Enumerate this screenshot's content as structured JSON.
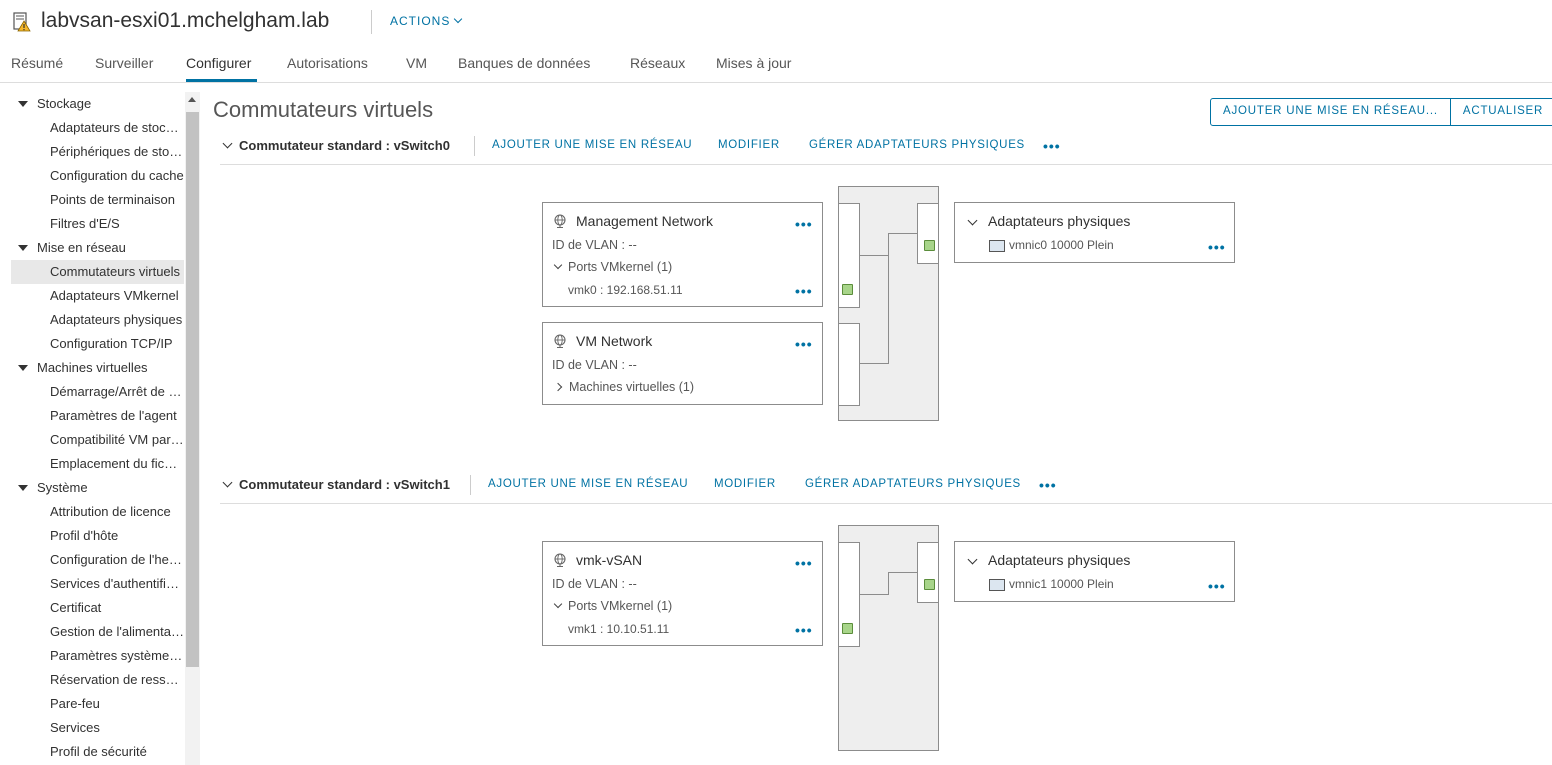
{
  "header": {
    "host_title": "labvsan-esxi01.mchelgham.lab",
    "actions_label": "ACTIONS"
  },
  "tabs": [
    "Résumé",
    "Surveiller",
    "Configurer",
    "Autorisations",
    "VM",
    "Banques de données",
    "Réseaux",
    "Mises à jour"
  ],
  "active_tab": "Configurer",
  "sidebar": {
    "rows": [
      {
        "label": "Stockage",
        "type": "cat"
      },
      {
        "label": "Adaptateurs de stockage",
        "type": "leaf"
      },
      {
        "label": "Périphériques de stockage",
        "type": "leaf"
      },
      {
        "label": "Configuration du cache",
        "type": "leaf"
      },
      {
        "label": "Points de terminaison",
        "type": "leaf"
      },
      {
        "label": "Filtres d'E/S",
        "type": "leaf"
      },
      {
        "label": "Mise en réseau",
        "type": "cat"
      },
      {
        "label": "Commutateurs virtuels",
        "type": "leaf",
        "selected": true
      },
      {
        "label": "Adaptateurs VMkernel",
        "type": "leaf"
      },
      {
        "label": "Adaptateurs physiques",
        "type": "leaf"
      },
      {
        "label": "Configuration TCP/IP",
        "type": "leaf"
      },
      {
        "label": "Machines virtuelles",
        "type": "cat"
      },
      {
        "label": "Démarrage/Arrêt de VM",
        "type": "leaf"
      },
      {
        "label": "Paramètres de l'agent",
        "type": "leaf"
      },
      {
        "label": "Compatibilité VM par défaut",
        "type": "leaf"
      },
      {
        "label": "Emplacement du fichier",
        "type": "leaf"
      },
      {
        "label": "Système",
        "type": "cat"
      },
      {
        "label": "Attribution de licence",
        "type": "leaf"
      },
      {
        "label": "Profil d'hôte",
        "type": "leaf"
      },
      {
        "label": "Configuration de l'heure",
        "type": "leaf"
      },
      {
        "label": "Services d'authentification",
        "type": "leaf"
      },
      {
        "label": "Certificat",
        "type": "leaf"
      },
      {
        "label": "Gestion de l'alimentation",
        "type": "leaf"
      },
      {
        "label": "Paramètres système avancés",
        "type": "leaf"
      },
      {
        "label": "Réservation de ressources",
        "type": "leaf"
      },
      {
        "label": "Pare-feu",
        "type": "leaf"
      },
      {
        "label": "Services",
        "type": "leaf"
      },
      {
        "label": "Profil de sécurité",
        "type": "leaf"
      }
    ]
  },
  "main": {
    "title": "Commutateurs virtuels",
    "add_networking_label": "AJOUTER UNE MISE EN RÉSEAU...",
    "refresh_label": "ACTUALISER",
    "switch_actions": {
      "add_label": "AJOUTER UNE MISE EN RÉSEAU",
      "edit_label": "MODIFIER",
      "manage_label": "GÉRER ADAPTATEURS PHYSIQUES",
      "more": "•••"
    },
    "switches": [
      {
        "name": "Commutateur standard : vSwitch0",
        "portgroups": [
          {
            "name": "Management Network",
            "vlan": "ID de VLAN : --",
            "section": "Ports VMkernel (1)",
            "item": "vmk0 : 192.168.51.11"
          },
          {
            "name": "VM Network",
            "vlan": "ID de VLAN : --",
            "section": "Machines virtuelles (1)"
          }
        ],
        "physical": {
          "title": "Adaptateurs physiques",
          "nic": "vmnic0 10000 Plein"
        }
      },
      {
        "name": "Commutateur standard : vSwitch1",
        "portgroups": [
          {
            "name": "vmk-vSAN",
            "vlan": "ID de VLAN : --",
            "section": "Ports VMkernel (1)",
            "item": "vmk1 : 10.10.51.11"
          }
        ],
        "physical": {
          "title": "Adaptateurs physiques",
          "nic": "vmnic1 10000 Plein"
        }
      }
    ]
  }
}
